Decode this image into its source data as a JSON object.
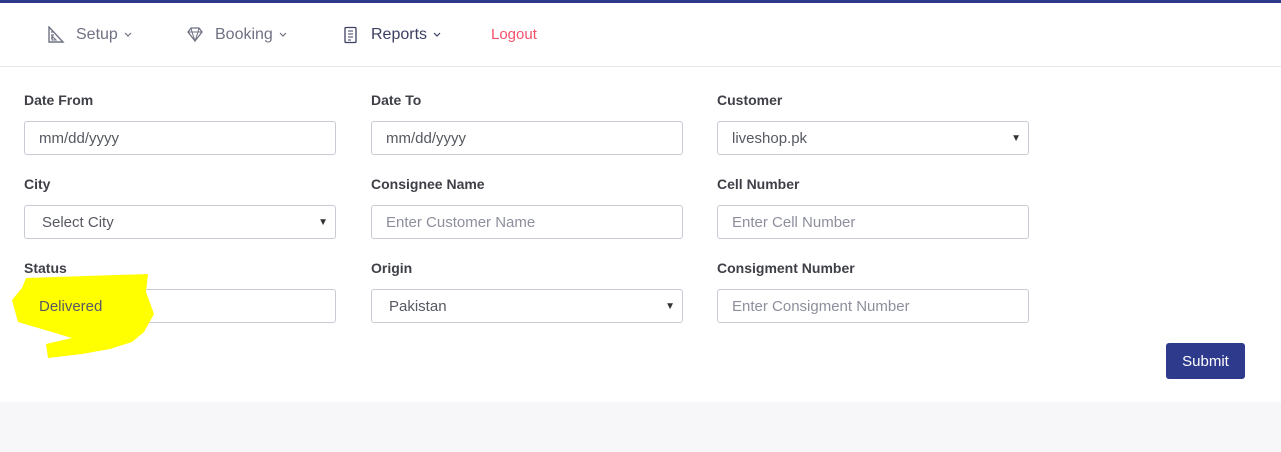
{
  "nav": {
    "setup": {
      "label": "Setup",
      "icon": "ruler-triangle-icon"
    },
    "booking": {
      "label": "Booking",
      "icon": "diamond-icon"
    },
    "reports": {
      "label": "Reports",
      "icon": "document-icon"
    },
    "logout": {
      "label": "Logout"
    }
  },
  "form": {
    "date_from": {
      "label": "Date From",
      "value": "mm/dd/yyyy"
    },
    "date_to": {
      "label": "Date To",
      "value": "mm/dd/yyyy"
    },
    "customer": {
      "label": "Customer",
      "value": "liveshop.pk"
    },
    "city": {
      "label": "City",
      "value": "Select City"
    },
    "consignee_name": {
      "label": "Consignee Name",
      "placeholder": "Enter Customer Name"
    },
    "cell_number": {
      "label": "Cell Number",
      "placeholder": "Enter Cell Number"
    },
    "status": {
      "label": "Status",
      "value": "Delivered"
    },
    "origin": {
      "label": "Origin",
      "value": "Pakistan"
    },
    "consignment_number": {
      "label": "Consigment Number",
      "placeholder": "Enter Consigment Number"
    },
    "submit_label": "Submit"
  },
  "colors": {
    "accent": "#2e3a8c",
    "logout": "#f4516c",
    "highlight": "#ffff00"
  }
}
